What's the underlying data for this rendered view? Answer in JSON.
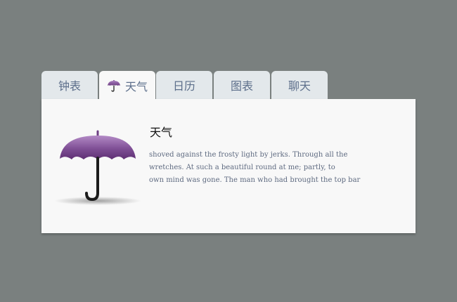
{
  "tabs": [
    {
      "label": "钟表",
      "active": false
    },
    {
      "label": "天气",
      "active": true,
      "icon": "umbrella-icon"
    },
    {
      "label": "日历",
      "active": false
    },
    {
      "label": "图表",
      "active": false
    },
    {
      "label": "聊天",
      "active": false
    }
  ],
  "panel": {
    "title": "天气",
    "lines": [
      "shoved against the frosty light by jerks. Through all the",
      "wretches. At such a beautiful round at me; partly, to",
      "own mind was gone. The man who had brought the top bar"
    ],
    "illustration": "umbrella-icon"
  },
  "colors": {
    "background": "#7a807f",
    "tab": "#e3e8eb",
    "panel": "#f8f8f8",
    "tab_text": "#5d6f8b",
    "umbrella": "#7b4f8f"
  }
}
